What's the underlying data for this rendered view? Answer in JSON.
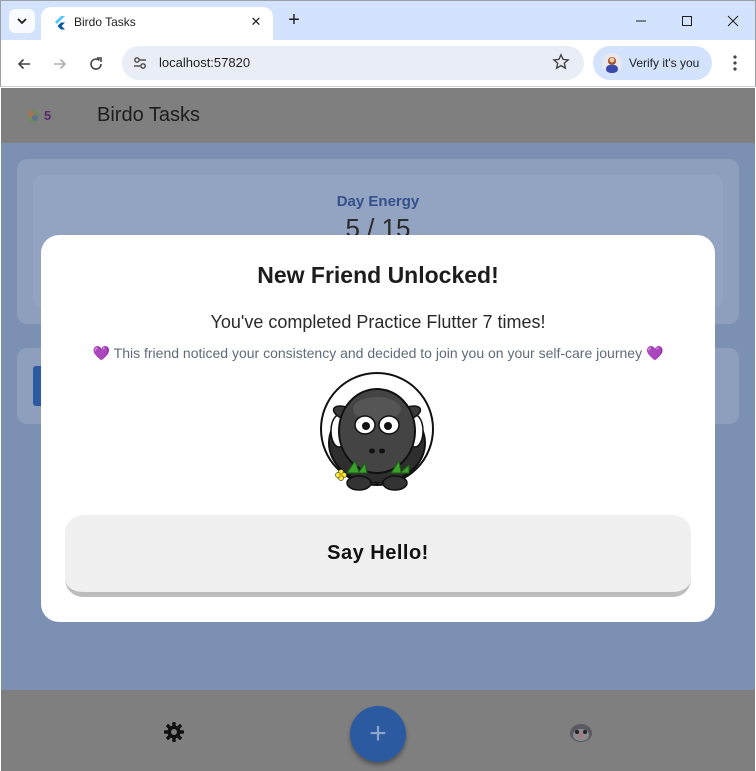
{
  "browser": {
    "tab_title": "Birdo Tasks",
    "url": "localhost:57820",
    "verify_label": "Verify it's you"
  },
  "app": {
    "points": "5",
    "title": "Birdo Tasks",
    "energy_label": "Day Energy",
    "energy_value": "5 / 15"
  },
  "dialog": {
    "title": "New Friend Unlocked!",
    "subtitle": "You've completed Practice Flutter 7 times!",
    "note": "💜 This friend noticed your consistency and decided to join you on your self-care journey 💜",
    "button_label": "Say Hello!",
    "friend_image": "black-sheep-illustration"
  },
  "bottom_nav": {
    "fab_symbol": "+",
    "items": [
      "gear-icon",
      "add-task-button",
      "pet-icon"
    ]
  },
  "colors": {
    "accent": "#2c5aa0",
    "background": "#7b90b3",
    "dialog_button": "#f0f0f0"
  }
}
